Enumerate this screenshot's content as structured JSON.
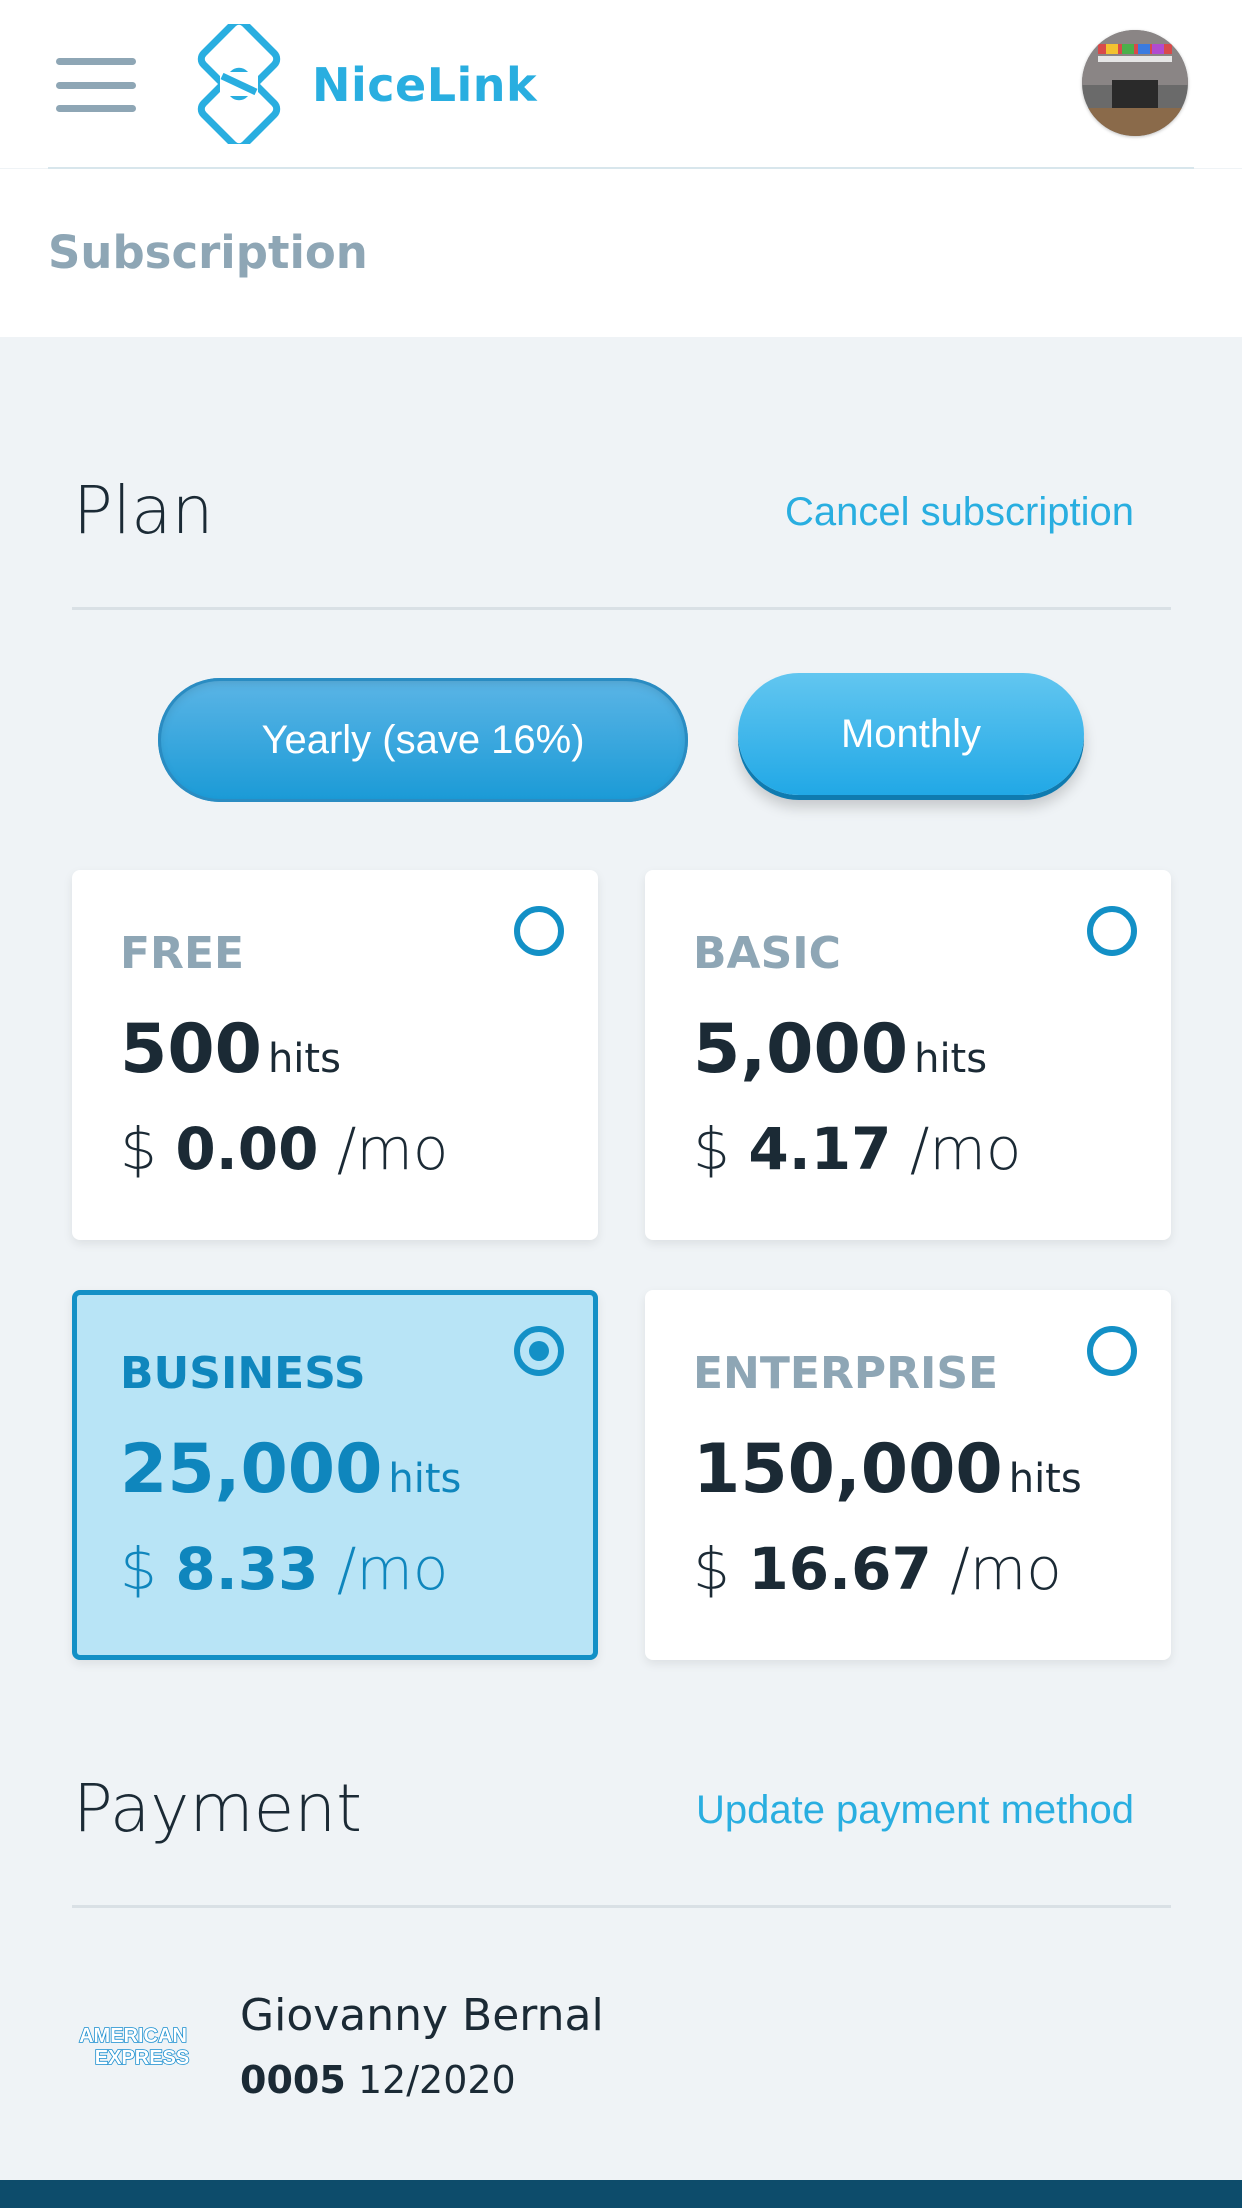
{
  "header": {
    "brand": "NiceLink",
    "menu_icon": "hamburger-menu-icon",
    "logo_icon": "chain-link-logo-icon",
    "avatar": "user-avatar"
  },
  "page": {
    "title": "Subscription"
  },
  "plan": {
    "title": "Plan",
    "cancel_link": "Cancel subscription",
    "billing_toggle": {
      "yearly_label": "Yearly (save 16%)",
      "monthly_label": "Monthly",
      "selected": "Monthly"
    },
    "options": [
      {
        "name": "FREE",
        "hits": "500",
        "hits_unit": "hits",
        "currency": "$",
        "price": "0.00",
        "period": "/mo",
        "selected": false
      },
      {
        "name": "BASIC",
        "hits": "5,000",
        "hits_unit": "hits",
        "currency": "$",
        "price": "4.17",
        "period": "/mo",
        "selected": false
      },
      {
        "name": "BUSINESS",
        "hits": "25,000",
        "hits_unit": "hits",
        "currency": "$",
        "price": "8.33",
        "period": "/mo",
        "selected": true
      },
      {
        "name": "ENTERPRISE",
        "hits": "150,000",
        "hits_unit": "hits",
        "currency": "$",
        "price": "16.67",
        "period": "/mo",
        "selected": false
      }
    ]
  },
  "payment": {
    "title": "Payment",
    "update_link": "Update payment method",
    "card_brand_icon": "american-express-icon",
    "card_brand_text": [
      "AMERICAN",
      "EXPRESS"
    ],
    "holder": "Giovanny Bernal",
    "last4": "0005",
    "expiry": "12/2020"
  },
  "colors": {
    "accent": "#29aee0",
    "selected_border": "#1390c6",
    "selected_bg": "#b8e4f6",
    "muted": "#8ea6b5",
    "footer": "#0d4c6b"
  }
}
